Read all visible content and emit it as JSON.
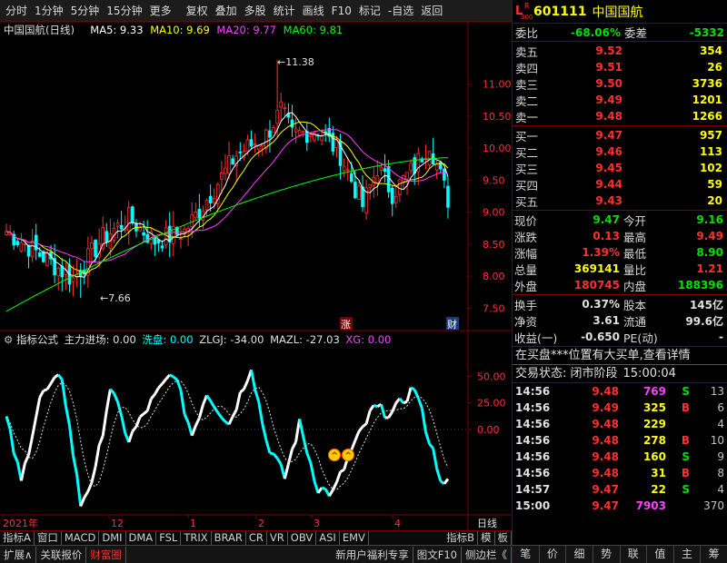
{
  "menu": {
    "left": [
      "分时",
      "1分钟",
      "5分钟",
      "15分钟",
      "更多"
    ],
    "right": [
      "复权",
      "叠加",
      "多股",
      "统计",
      "画线",
      "F10",
      "标记",
      "-自选",
      "返回"
    ]
  },
  "legend": {
    "title": "中国国航(日线)",
    "ma5": "MA5: 9.33",
    "ma10": "MA10: 9.69",
    "ma20": "MA20: 9.77",
    "ma60": "MA60: 9.81"
  },
  "indicator_legend": {
    "name": "指标公式",
    "zljc": "主力进场: 0.00",
    "xp": "洗盘: 0.00",
    "zlgj": "ZLGJ: -34.00",
    "mazl": "MAZL: -27.03",
    "xg": "XG: 0.00"
  },
  "colors": {
    "ma5": "#ffffff",
    "ma10": "#ffff00",
    "ma20": "#ff40ff",
    "ma60": "#00ff00",
    "up": "#ff3030",
    "down": "#00ffff",
    "grid": "#7a0000"
  },
  "chart_data": [
    {
      "type": "candlestick",
      "title": "中国国航(日线)",
      "y_ticks": [
        7.5,
        8.0,
        8.5,
        9.0,
        9.5,
        10.0,
        10.5,
        11.0
      ],
      "ylim": [
        7.32,
        11.72
      ],
      "annotations": {
        "high": "11.38",
        "low": "7.66"
      },
      "series": [
        {
          "name": "MA5",
          "value": 9.33
        },
        {
          "name": "MA10",
          "value": 9.69
        },
        {
          "name": "MA20",
          "value": 9.77
        },
        {
          "name": "MA60",
          "value": 9.81
        }
      ],
      "markers": [
        "涨",
        "财"
      ]
    },
    {
      "type": "line",
      "title": "指标公式",
      "y_ticks": [
        0.0,
        25.0,
        50.0
      ],
      "ylim": [
        -80,
        80
      ],
      "series": [
        {
          "name": "ZLGJ",
          "value": -34.0
        },
        {
          "name": "MAZL",
          "value": -27.03
        }
      ]
    }
  ],
  "x_axis": {
    "labels": [
      "2021年",
      "12",
      "1",
      "2",
      "3",
      "4"
    ],
    "period": "日线"
  },
  "tabs1": [
    "指标A",
    "窗口",
    "MACD",
    "DMI",
    "DMA",
    "FSL",
    "TRIX",
    "BRAR",
    "CR",
    "VR",
    "OBV",
    "ASI",
    "EMV",
    "指标B",
    "模",
    "板"
  ],
  "tabs2": [
    "扩展∧",
    "关联报价",
    "财富圈",
    "新用户福利专享",
    "图文F10",
    "侧边栏《"
  ],
  "stock": {
    "badge_l": "L",
    "badge_r": "R",
    "badge_n": "300",
    "code": "601111",
    "name": "中国国航"
  },
  "ratio": {
    "wb_label": "委比",
    "wb_value": "-68.06%",
    "wc_label": "委差",
    "wc_value": "-5332"
  },
  "asks": [
    {
      "label": "卖五",
      "price": "9.52",
      "vol": "354"
    },
    {
      "label": "卖四",
      "price": "9.51",
      "vol": "26"
    },
    {
      "label": "卖三",
      "price": "9.50",
      "vol": "3736"
    },
    {
      "label": "卖二",
      "price": "9.49",
      "vol": "1201"
    },
    {
      "label": "卖一",
      "price": "9.48",
      "vol": "1266"
    }
  ],
  "bids": [
    {
      "label": "买一",
      "price": "9.47",
      "vol": "957"
    },
    {
      "label": "买二",
      "price": "9.46",
      "vol": "113"
    },
    {
      "label": "买三",
      "price": "9.45",
      "vol": "102"
    },
    {
      "label": "买四",
      "price": "9.44",
      "vol": "59"
    },
    {
      "label": "买五",
      "price": "9.43",
      "vol": "20"
    }
  ],
  "stats1": [
    {
      "l1": "现价",
      "v1": "9.47",
      "c1": "green",
      "l2": "今开",
      "v2": "9.16",
      "c2": "green"
    },
    {
      "l1": "涨跌",
      "v1": "0.13",
      "c1": "red",
      "l2": "最高",
      "v2": "9.49",
      "c2": "red"
    },
    {
      "l1": "涨幅",
      "v1": "1.39%",
      "c1": "red",
      "l2": "最低",
      "v2": "8.90",
      "c2": "green"
    },
    {
      "l1": "总量",
      "v1": "369141",
      "c1": "yellow",
      "l2": "量比",
      "v2": "1.21",
      "c2": "red"
    },
    {
      "l1": "外盘",
      "v1": "180745",
      "c1": "red",
      "l2": "内盘",
      "v2": "188396",
      "c2": "green"
    }
  ],
  "stats2": [
    {
      "l1": "换手",
      "v1": "0.37%",
      "l2": "股本",
      "v2": "145亿"
    },
    {
      "l1": "净资",
      "v1": "3.61",
      "l2": "流通",
      "v2": "99.6亿"
    },
    {
      "l1": "收益(一)",
      "v1": "-0.650",
      "l2": "PE(动)",
      "v2": "-"
    }
  ],
  "messages": {
    "m1": "在买盘***位置有大买单,查看详情",
    "m2": "交易状态: 闭市阶段",
    "m2_time": "15:00:04"
  },
  "ticks": [
    {
      "t": "14:56",
      "p": "9.48",
      "v": "769",
      "vc": "magenta",
      "bs": "S",
      "bsc": "green",
      "c": "13"
    },
    {
      "t": "14:56",
      "p": "9.49",
      "v": "325",
      "vc": "yellow",
      "bs": "B",
      "bsc": "red",
      "c": "6"
    },
    {
      "t": "14:56",
      "p": "9.48",
      "v": "229",
      "vc": "yellow",
      "bs": "",
      "bsc": "red",
      "c": "4"
    },
    {
      "t": "14:56",
      "p": "9.48",
      "v": "278",
      "vc": "yellow",
      "bs": "B",
      "bsc": "red",
      "c": "10"
    },
    {
      "t": "14:56",
      "p": "9.48",
      "v": "160",
      "vc": "yellow",
      "bs": "S",
      "bsc": "green",
      "c": "9"
    },
    {
      "t": "14:56",
      "p": "9.48",
      "v": "31",
      "vc": "yellow",
      "bs": "B",
      "bsc": "red",
      "c": "8"
    },
    {
      "t": "14:57",
      "p": "9.47",
      "v": "22",
      "vc": "yellow",
      "bs": "S",
      "bsc": "green",
      "c": "4"
    },
    {
      "t": "15:00",
      "p": "9.47",
      "v": "7903",
      "vc": "magenta",
      "bs": "",
      "bsc": "red",
      "c": "370"
    }
  ],
  "bottom_icons": [
    "笔",
    "价",
    "细",
    "势",
    "联",
    "值",
    "主",
    "筹"
  ]
}
